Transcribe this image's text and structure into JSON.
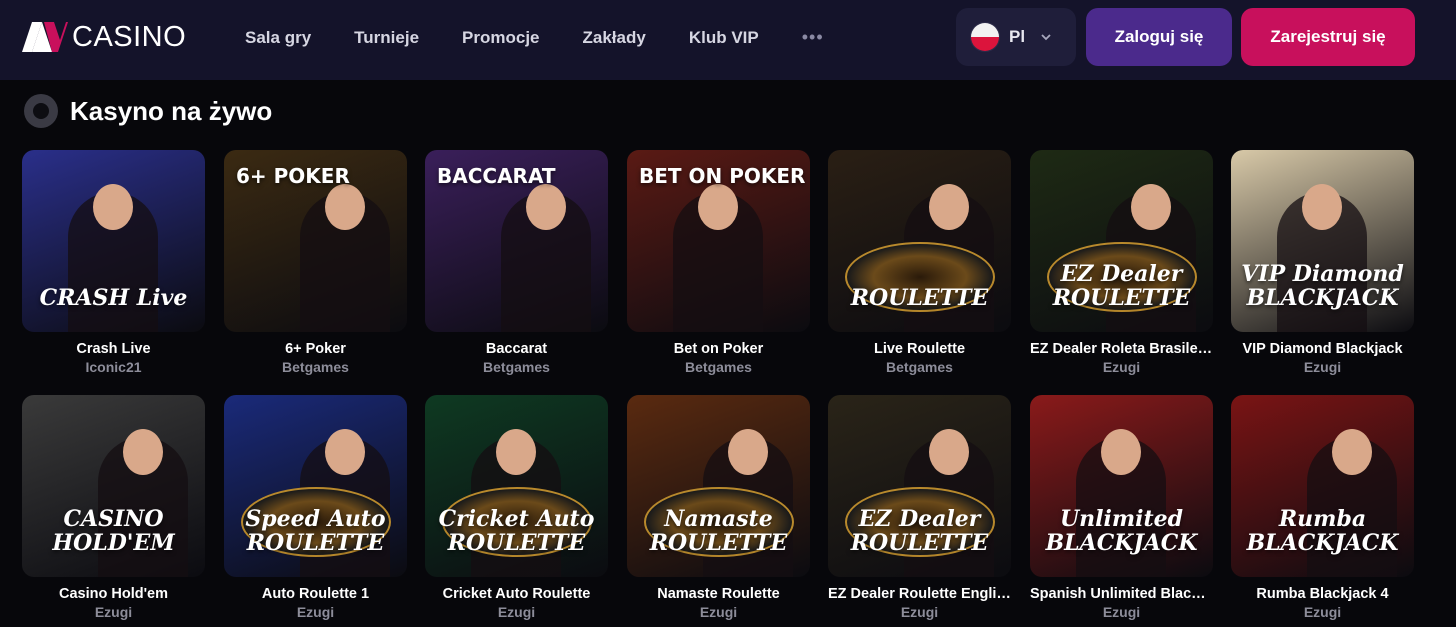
{
  "header": {
    "logo_text": "CASINO",
    "nav": [
      "Sala gry",
      "Turnieje",
      "Promocje",
      "Zakłady",
      "Klub VIP"
    ],
    "nav_more": "•••",
    "language": "Pl",
    "login_label": "Zaloguj się",
    "register_label": "Zarejestruj się"
  },
  "section": {
    "title": "Kasyno na żywo"
  },
  "games": [
    {
      "name": "Crash Live",
      "provider": "Iconic21",
      "thumb_text": "CRASH Live",
      "bg": "#2a2f8a"
    },
    {
      "name": "6+ Poker",
      "provider": "Betgames",
      "thumb_text": "6+ POKER",
      "bg": "#3b2a12"
    },
    {
      "name": "Baccarat",
      "provider": "Betgames",
      "thumb_text": "BACCARAT",
      "bg": "#3a1f5a"
    },
    {
      "name": "Bet on Poker",
      "provider": "Betgames",
      "thumb_text": "BET ON POKER",
      "bg": "#5a1a14"
    },
    {
      "name": "Live Roulette",
      "provider": "Betgames",
      "thumb_text": "ROULETTE",
      "bg": "#2a1f14"
    },
    {
      "name": "EZ Dealer Roleta Brasileira",
      "provider": "Ezugi",
      "thumb_text": "EZ Dealer ROULETTE",
      "bg": "#1e2a14"
    },
    {
      "name": "VIP Diamond Blackjack",
      "provider": "Ezugi",
      "thumb_text": "VIP Diamond BLACKJACK",
      "bg": "#d8c9a8"
    },
    {
      "name": "Casino Hold'em",
      "provider": "Ezugi",
      "thumb_text": "CASINO HOLD'EM",
      "bg": "#3a3a3a"
    },
    {
      "name": "Auto Roulette 1",
      "provider": "Ezugi",
      "thumb_text": "Speed Auto ROULETTE",
      "bg": "#1a2a7a"
    },
    {
      "name": "Cricket Auto Roulette",
      "provider": "Ezugi",
      "thumb_text": "Cricket Auto ROULETTE",
      "bg": "#0e3a22"
    },
    {
      "name": "Namaste Roulette",
      "provider": "Ezugi",
      "thumb_text": "Namaste ROULETTE",
      "bg": "#5a2a10"
    },
    {
      "name": "EZ Dealer Roulette English",
      "provider": "Ezugi",
      "thumb_text": "EZ Dealer ROULETTE",
      "bg": "#2a2418"
    },
    {
      "name": "Spanish Unlimited Blackjack",
      "provider": "Ezugi",
      "thumb_text": "Unlimited BLACKJACK",
      "bg": "#8a1a1a"
    },
    {
      "name": "Rumba Blackjack 4",
      "provider": "Ezugi",
      "thumb_text": "Rumba BLACKJACK",
      "bg": "#7a1414"
    }
  ]
}
